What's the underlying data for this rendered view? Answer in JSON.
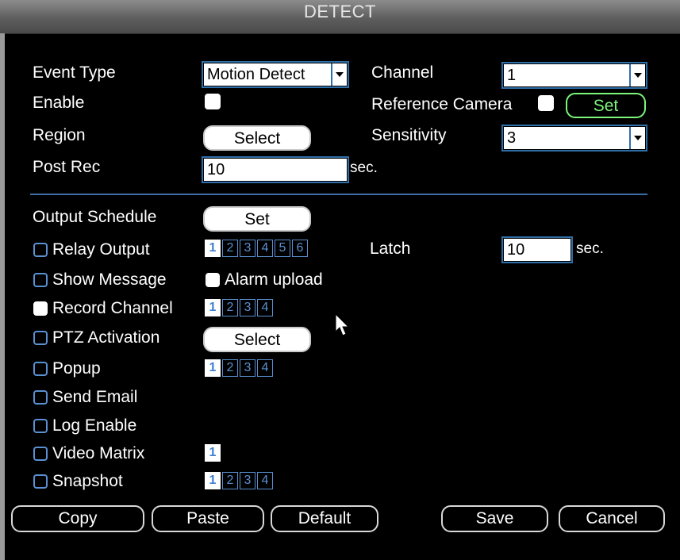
{
  "window": {
    "title": "DETECT"
  },
  "event_type": {
    "label": "Event Type",
    "value": "Motion Detect"
  },
  "channel": {
    "label": "Channel",
    "value": "1"
  },
  "enable": {
    "label": "Enable",
    "checked": false
  },
  "reference_camera": {
    "label": "Reference Camera",
    "checked": false,
    "set_label": "Set"
  },
  "region": {
    "label": "Region",
    "button": "Select"
  },
  "sensitivity": {
    "label": "Sensitivity",
    "value": "3"
  },
  "post_rec": {
    "label": "Post Rec",
    "value": "10",
    "unit": "sec."
  },
  "output_schedule": {
    "label": "Output Schedule",
    "button": "Set"
  },
  "relay_output": {
    "label": "Relay Output",
    "channels": [
      "1",
      "2",
      "3",
      "4",
      "5",
      "6"
    ],
    "selected": [
      "1"
    ]
  },
  "latch": {
    "label": "Latch",
    "value": "10",
    "unit": "sec."
  },
  "show_message": {
    "label": "Show Message"
  },
  "alarm_upload": {
    "label": "Alarm upload"
  },
  "record_channel": {
    "label": "Record Channel",
    "channels": [
      "1",
      "2",
      "3",
      "4"
    ],
    "selected": [
      "1"
    ]
  },
  "ptz_activation": {
    "label": "PTZ Activation",
    "button": "Select"
  },
  "popup": {
    "label": "Popup",
    "channels": [
      "1",
      "2",
      "3",
      "4"
    ],
    "selected": [
      "1"
    ]
  },
  "send_email": {
    "label": "Send Email"
  },
  "log_enable": {
    "label": "Log Enable"
  },
  "video_matrix": {
    "label": "Video Matrix",
    "channels": [
      "1"
    ],
    "selected": [
      "1"
    ]
  },
  "snapshot": {
    "label": "Snapshot",
    "channels": [
      "1",
      "2",
      "3",
      "4"
    ],
    "selected": [
      "1"
    ]
  },
  "buttons": {
    "copy": "Copy",
    "paste": "Paste",
    "default": "Default",
    "save": "Save",
    "cancel": "Cancel"
  },
  "icons": {
    "cursor": "mouse-pointer-icon",
    "dropdown": "chevron-down-icon"
  }
}
